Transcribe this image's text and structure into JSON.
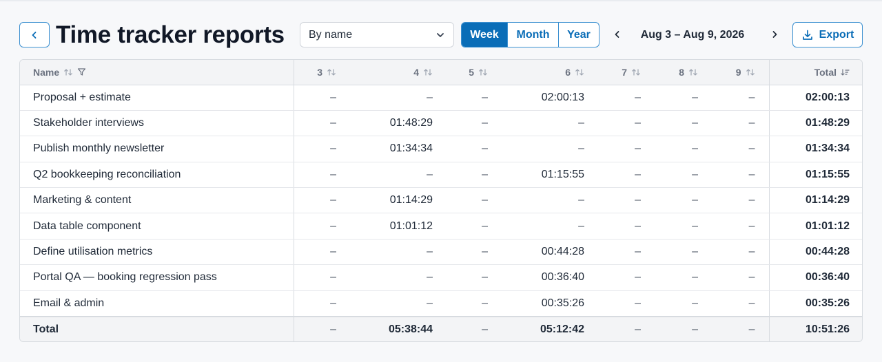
{
  "header": {
    "title": "Time tracker reports",
    "group_by": {
      "value": "By name"
    },
    "period_tabs": [
      {
        "label": "Week",
        "active": true
      },
      {
        "label": "Month",
        "active": false
      },
      {
        "label": "Year",
        "active": false
      }
    ],
    "date_range": "Aug 3 – Aug 9, 2026",
    "export_label": "Export"
  },
  "table": {
    "columns": {
      "name": "Name",
      "d3": "3",
      "d4": "4",
      "d5": "5",
      "d6": "6",
      "d7": "7",
      "d8": "8",
      "d9": "9",
      "total": "Total"
    },
    "rows": [
      {
        "name": "Proposal + estimate",
        "cells": [
          "–",
          "–",
          "–",
          "02:00:13",
          "–",
          "–",
          "–"
        ],
        "total": "02:00:13"
      },
      {
        "name": "Stakeholder interviews",
        "cells": [
          "–",
          "01:48:29",
          "–",
          "–",
          "–",
          "–",
          "–"
        ],
        "total": "01:48:29"
      },
      {
        "name": "Publish monthly newsletter",
        "cells": [
          "–",
          "01:34:34",
          "–",
          "–",
          "–",
          "–",
          "–"
        ],
        "total": "01:34:34"
      },
      {
        "name": "Q2 bookkeeping reconciliation",
        "cells": [
          "–",
          "–",
          "–",
          "01:15:55",
          "–",
          "–",
          "–"
        ],
        "total": "01:15:55"
      },
      {
        "name": "Marketing & content",
        "cells": [
          "–",
          "01:14:29",
          "–",
          "–",
          "–",
          "–",
          "–"
        ],
        "total": "01:14:29"
      },
      {
        "name": "Data table component",
        "cells": [
          "–",
          "01:01:12",
          "–",
          "–",
          "–",
          "–",
          "–"
        ],
        "total": "01:01:12"
      },
      {
        "name": "Define utilisation metrics",
        "cells": [
          "–",
          "–",
          "–",
          "00:44:28",
          "–",
          "–",
          "–"
        ],
        "total": "00:44:28"
      },
      {
        "name": "Portal QA — booking regression pass",
        "cells": [
          "–",
          "–",
          "–",
          "00:36:40",
          "–",
          "–",
          "–"
        ],
        "total": "00:36:40"
      },
      {
        "name": "Email & admin",
        "cells": [
          "–",
          "–",
          "–",
          "00:35:26",
          "–",
          "–",
          "–"
        ],
        "total": "00:35:26"
      }
    ],
    "footer": {
      "label": "Total",
      "cells": [
        "–",
        "05:38:44",
        "–",
        "05:12:42",
        "–",
        "–",
        "–"
      ],
      "total": "10:51:26"
    }
  },
  "colors": {
    "accent": "#0a6db7",
    "border": "#d7dbe0",
    "header_bg": "#f3f4f6"
  },
  "icons": [
    "chevron-left-icon",
    "chevron-down-icon",
    "chevron-right-icon",
    "download-icon",
    "sort-icon",
    "filter-icon",
    "sort-desc-icon"
  ]
}
